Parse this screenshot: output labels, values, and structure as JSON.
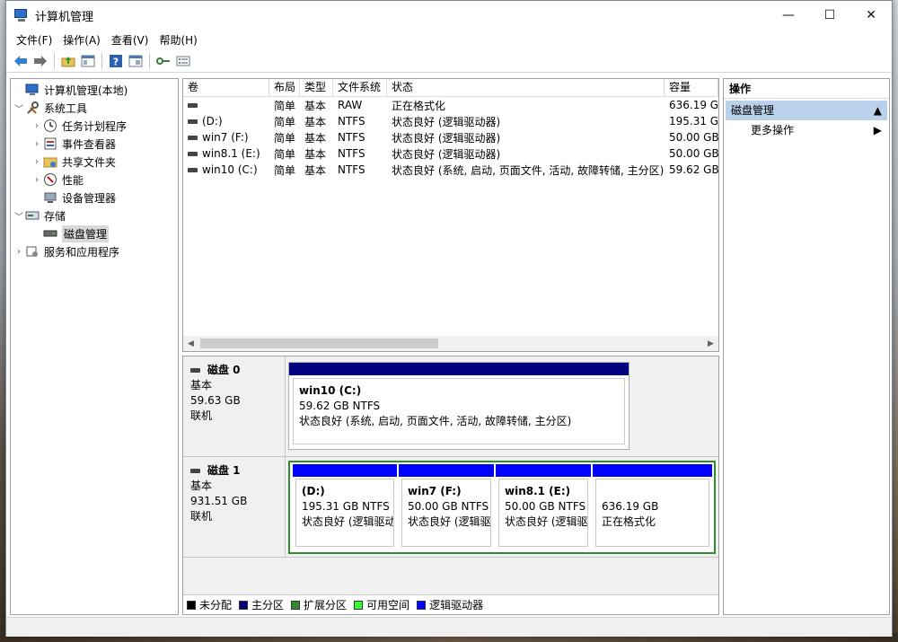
{
  "window": {
    "title": "计算机管理",
    "minimize": "—",
    "maximize": "☐",
    "close": "✕"
  },
  "menu": [
    "文件(F)",
    "操作(A)",
    "查看(V)",
    "帮助(H)"
  ],
  "tree": {
    "root": "计算机管理(本地)",
    "system_tools": "系统工具",
    "task_scheduler": "任务计划程序",
    "event_viewer": "事件查看器",
    "shared_folders": "共享文件夹",
    "performance": "性能",
    "device_manager": "设备管理器",
    "storage": "存储",
    "disk_management": "磁盘管理",
    "services_apps": "服务和应用程序"
  },
  "list": {
    "headers": [
      "卷",
      "布局",
      "类型",
      "文件系统",
      "状态",
      "容量"
    ],
    "rows": [
      {
        "vol": "",
        "layout": "简单",
        "type": "基本",
        "fs": "RAW",
        "status": "正在格式化",
        "cap": "636.19 G"
      },
      {
        "vol": "(D:)",
        "layout": "简单",
        "type": "基本",
        "fs": "NTFS",
        "status": "状态良好 (逻辑驱动器)",
        "cap": "195.31 G"
      },
      {
        "vol": "win7 (F:)",
        "layout": "简单",
        "type": "基本",
        "fs": "NTFS",
        "status": "状态良好 (逻辑驱动器)",
        "cap": "50.00 GB"
      },
      {
        "vol": "win8.1 (E:)",
        "layout": "简单",
        "type": "基本",
        "fs": "NTFS",
        "status": "状态良好 (逻辑驱动器)",
        "cap": "50.00 GB"
      },
      {
        "vol": "win10 (C:)",
        "layout": "简单",
        "type": "基本",
        "fs": "NTFS",
        "status": "状态良好 (系统, 启动, 页面文件, 活动, 故障转储, 主分区)",
        "cap": "59.62 GB"
      }
    ]
  },
  "disk0": {
    "name": "磁盘 0",
    "kind": "基本",
    "size": "59.63 GB",
    "state": "联机",
    "p1": {
      "title": "win10  (C:)",
      "size": "59.62 GB NTFS",
      "status": "状态良好 (系统, 启动, 页面文件, 活动, 故障转储, 主分区)"
    }
  },
  "disk1": {
    "name": "磁盘 1",
    "kind": "基本",
    "size": "931.51 GB",
    "state": "联机",
    "p1": {
      "title": "(D:)",
      "size": "195.31 GB NTFS",
      "status": "状态良好 (逻辑驱动器)"
    },
    "p2": {
      "title": "win7  (F:)",
      "size": "50.00 GB NTFS",
      "status": "状态良好 (逻辑驱动器)"
    },
    "p3": {
      "title": "win8.1  (E:)",
      "size": "50.00 GB NTFS",
      "status": "状态良好 (逻辑驱动器)"
    },
    "p4": {
      "size": "636.19 GB",
      "status": "正在格式化"
    }
  },
  "legend": [
    "未分配",
    "主分区",
    "扩展分区",
    "可用空间",
    "逻辑驱动器"
  ],
  "colors": {
    "unallocated": "#000000",
    "primary": "#00007f",
    "extended": "#2e8b2e",
    "free": "#33ff33",
    "logical": "#0000ff"
  },
  "actions": {
    "header": "操作",
    "selected": "磁盘管理",
    "more": "更多操作"
  }
}
